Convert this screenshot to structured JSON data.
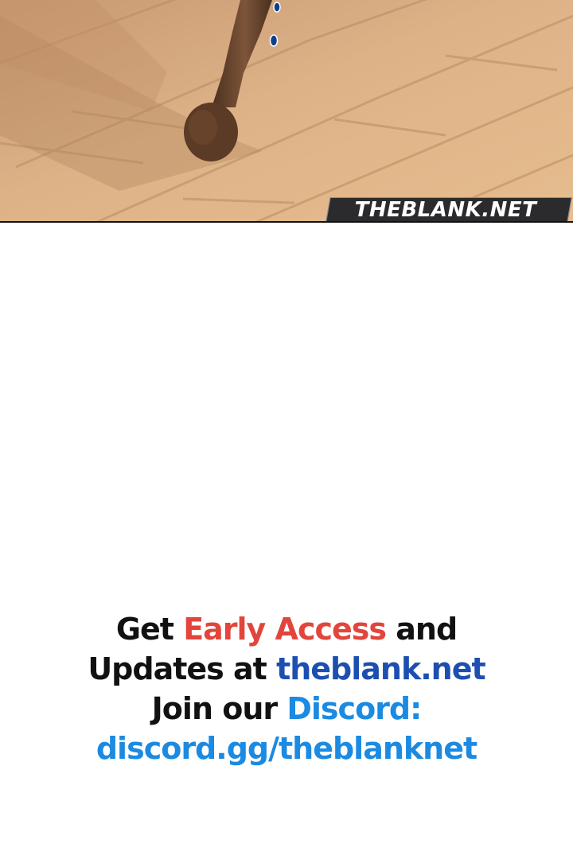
{
  "watermark": {
    "text": "THEBLANK.NET"
  },
  "promo": {
    "line1": {
      "part1": "Get ",
      "highlight": "Early Access",
      "part2": " and"
    },
    "line2": {
      "part1": "Updates at ",
      "link": "theblank.net"
    },
    "line3": {
      "part1": "Join our ",
      "highlight": "Discord:"
    },
    "line4": {
      "link": "discord.gg/theblanknet"
    }
  },
  "colors": {
    "highlight_red": "#e2453b",
    "link_navy": "#1d4fb0",
    "link_blue": "#1b8ae2",
    "floor": "#d8ae82"
  }
}
